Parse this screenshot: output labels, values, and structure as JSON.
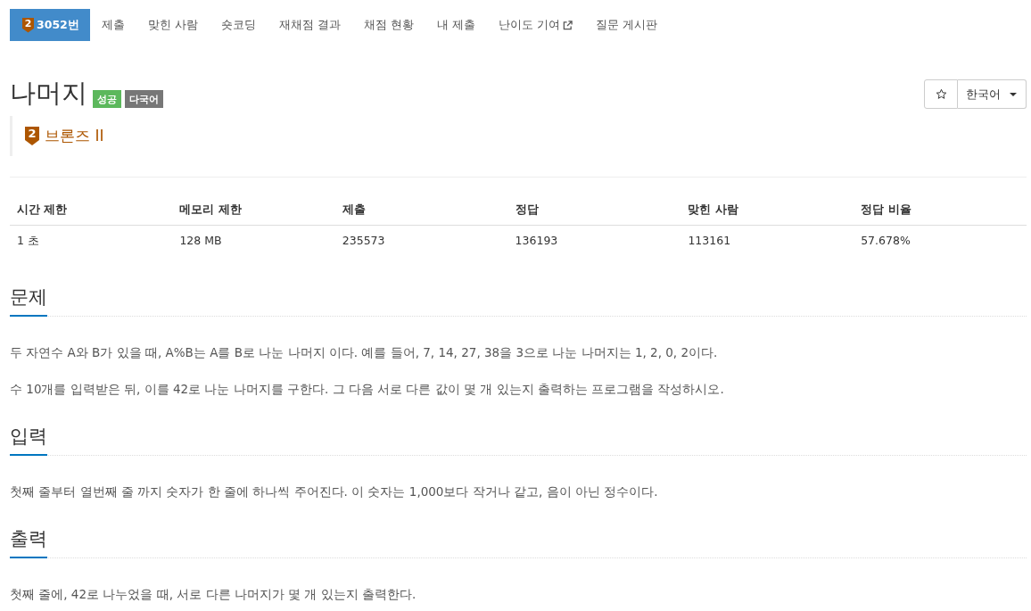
{
  "tabs": [
    {
      "label": "3052번",
      "selected": true,
      "kind": "problem",
      "tier": "2"
    },
    {
      "label": "제출",
      "selected": false,
      "kind": "link"
    },
    {
      "label": "맞힌 사람",
      "selected": false,
      "kind": "link"
    },
    {
      "label": "숏코딩",
      "selected": false,
      "kind": "link"
    },
    {
      "label": "재채점 결과",
      "selected": false,
      "kind": "link"
    },
    {
      "label": "채점 현황",
      "selected": false,
      "kind": "link"
    },
    {
      "label": "내 제출",
      "selected": false,
      "kind": "link"
    },
    {
      "label": "난이도 기여",
      "selected": false,
      "kind": "external"
    },
    {
      "label": "질문 게시판",
      "selected": false,
      "kind": "link"
    }
  ],
  "problem": {
    "title": "나머지",
    "labels": [
      {
        "text": "성공",
        "color": "#5cb85c"
      },
      {
        "text": "다국어",
        "color": "#777777"
      }
    ],
    "tier": {
      "number": "2",
      "name": "브론즈 II"
    }
  },
  "toolbar": {
    "language": "한국어"
  },
  "limits_table": {
    "columns": [
      "시간 제한",
      "메모리 제한",
      "제출",
      "정답",
      "맞힌 사람",
      "정답 비율"
    ],
    "rows": [
      [
        "1 초",
        "128 MB",
        "235573",
        "136193",
        "113161",
        "57.678%"
      ]
    ]
  },
  "sections": [
    {
      "heading": "문제",
      "paragraphs": [
        "두 자연수 A와 B가 있을 때, A%B는 A를 B로 나눈 나머지 이다. 예를 들어, 7, 14, 27, 38을 3으로 나눈 나머지는 1, 2, 0, 2이다.",
        "수 10개를 입력받은 뒤, 이를 42로 나눈 나머지를 구한다. 그 다음 서로 다른 값이 몇 개 있는지 출력하는 프로그램을 작성하시오."
      ]
    },
    {
      "heading": "입력",
      "paragraphs": [
        "첫째 줄부터 열번째 줄 까지 숫자가 한 줄에 하나씩 주어진다. 이 숫자는 1,000보다 작거나 같고, 음이 아닌 정수이다."
      ]
    },
    {
      "heading": "출력",
      "paragraphs": [
        "첫째 줄에, 42로 나누었을 때, 서로 다른 나머지가 몇 개 있는지 출력한다."
      ]
    }
  ]
}
